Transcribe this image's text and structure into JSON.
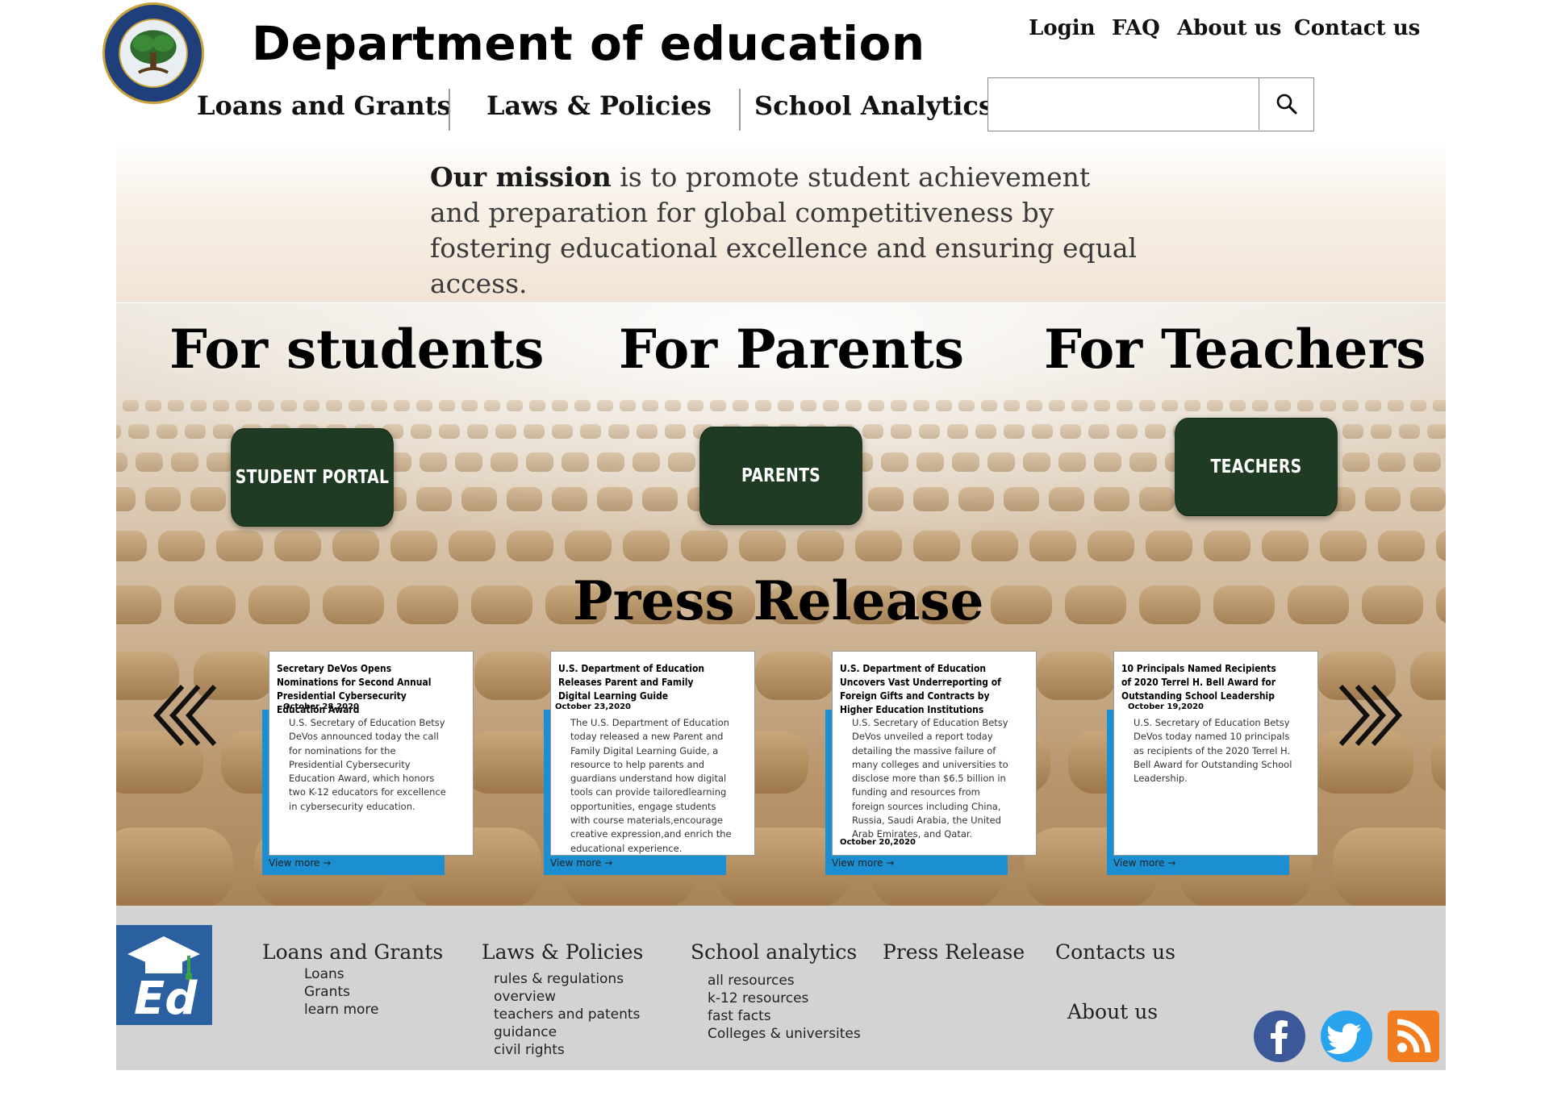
{
  "header": {
    "site_title": "Department of education",
    "top_links": [
      "Login",
      "FAQ",
      "About us",
      "Contact us"
    ],
    "main_nav": [
      "Loans and Grants",
      "Laws & Policies",
      "School Analytics"
    ],
    "search": {
      "value": "",
      "placeholder": ""
    }
  },
  "mission": {
    "lead": "Our mission",
    "text": " is to promote student achievement and preparation for global competitiveness by fostering educational excellence and ensuring equal access."
  },
  "audiences": [
    {
      "heading": "For students",
      "button": "Student Portal"
    },
    {
      "heading": "For Parents",
      "button": "Parents"
    },
    {
      "heading": "For Teachers",
      "button": "Teachers"
    }
  ],
  "press": {
    "title": "Press Release",
    "view_more": "View more",
    "cards": [
      {
        "title": "Secretary DeVos Opens Nominations for Second Annual Presidential Cybersecurity Education Award",
        "date": "October 28,2020",
        "body": "U.S. Secretary of Education Betsy DeVos announced today the call for nominations for the Presidential Cybersecurity Education Award, which honors two K-12 educators for excellence in cybersecurity education."
      },
      {
        "title": "U.S. Department of Education Releases Parent and Family Digital Learning Guide",
        "date": "October 23,2020",
        "body": "The U.S. Department of Education today released a new Parent and Family Digital Learning Guide, a resource to help parents and guardians understand how digital tools can provide tailoredlearning opportunities, engage students with course materials,encourage creative expression,and enrich the educational experience."
      },
      {
        "title": "U.S. Department of Education Uncovers Vast Underreporting of Foreign Gifts and Contracts by Higher Education Institutions",
        "date": "October 20,2020",
        "body": "U.S. Secretary of Education Betsy DeVos unveiled a report today detailing the massive failure of many colleges and universities to disclose more than $6.5 billion in funding and resources from foreign sources including China, Russia, Saudi Arabia, the United Arab Emirates, and Qatar."
      },
      {
        "title": "10 Principals Named Recipients of 2020 Terrel H. Bell Award for Outstanding School Leadership",
        "date": "October 19,2020",
        "body": "U.S. Secretary of Education Betsy DeVos today named 10 principals as recipients of the 2020 Terrel H. Bell Award for Outstanding School Leadership."
      }
    ]
  },
  "footer": {
    "columns": [
      {
        "heading": "Loans and Grants",
        "links": [
          "Loans",
          "Grants",
          "learn more"
        ]
      },
      {
        "heading": "Laws & Policies",
        "links": [
          "rules & regulations",
          "overview",
          "teachers and patents",
          "guidance",
          "civil rights"
        ]
      },
      {
        "heading": "School analytics",
        "links": [
          "all resources",
          "k-12 resources",
          "fast facts",
          "Colleges & universites"
        ]
      },
      {
        "heading": "Press Release",
        "links": []
      },
      {
        "heading": "Contacts us",
        "links": []
      }
    ],
    "about": "About us",
    "social_icons": [
      "facebook-icon",
      "twitter-icon",
      "rss-icon"
    ]
  },
  "colors": {
    "portal_button": "#1f3b24",
    "card_accent": "#1b8fd1",
    "footer_bg": "#d3d3d3",
    "logo_blue": "#2a5fa0"
  }
}
